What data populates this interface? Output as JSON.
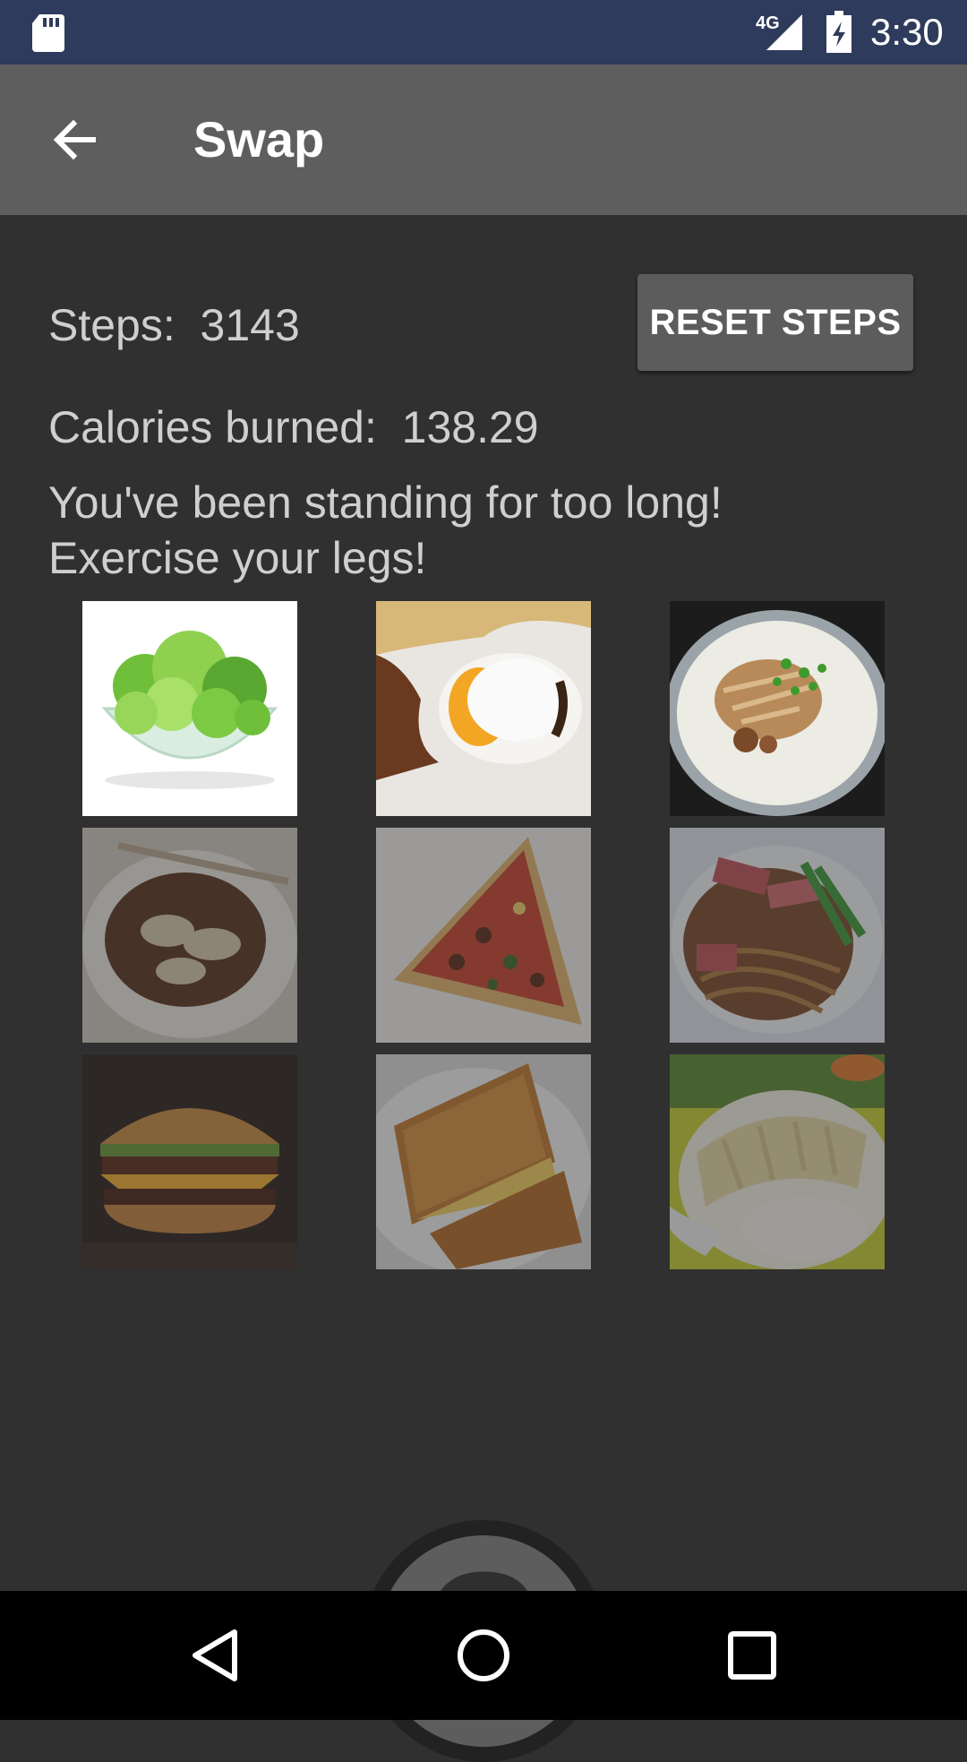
{
  "status_bar": {
    "network": "4G",
    "time": "3:30"
  },
  "app_bar": {
    "title": "Swap"
  },
  "steps": {
    "label": "Steps:",
    "value": "3143"
  },
  "calories": {
    "label": "Calories burned:",
    "value": "138.29"
  },
  "message": {
    "line1": "You've been standing for too long!",
    "line2": "Exercise your legs!"
  },
  "reset_button": {
    "label": "RESET STEPS"
  },
  "food_grid": [
    {
      "name": "lettuce salad",
      "state": "available"
    },
    {
      "name": "soft-boiled egg",
      "state": "available"
    },
    {
      "name": "chicken porridge",
      "state": "available"
    },
    {
      "name": "chee cheong fun",
      "state": "locked"
    },
    {
      "name": "pizza slice",
      "state": "locked"
    },
    {
      "name": "wanton noodles",
      "state": "locked"
    },
    {
      "name": "cheeseburger",
      "state": "locked"
    },
    {
      "name": "grilled cheese sandwich",
      "state": "locked"
    },
    {
      "name": "chicken rice",
      "state": "locked"
    }
  ],
  "help_button": {
    "symbol": "?"
  },
  "colors": {
    "status_bar": "#2f3b5c",
    "app_bar": "#5e5e5e",
    "background": "#303030",
    "button": "#5c5c5c"
  }
}
